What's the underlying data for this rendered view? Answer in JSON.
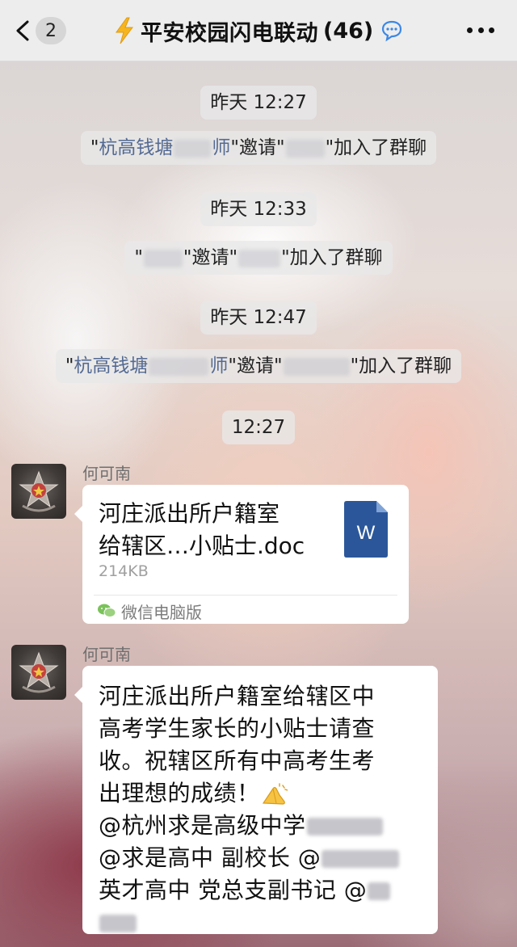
{
  "header": {
    "unread_count": "2",
    "title": "平安校园闪电联动",
    "member_count": "(46)"
  },
  "system_messages": [
    {
      "time": "昨天 12:27",
      "quote1": "\"",
      "inviter": "杭高钱塘",
      "inviter_suffix": "师",
      "mid": "\"邀请\"",
      "end": "\"加入了群聊"
    },
    {
      "time": "昨天 12:33",
      "quote1": "\"",
      "mid": "\"邀请\"",
      "end": "\"加入了群聊"
    },
    {
      "time": "昨天 12:47",
      "quote1": "\"",
      "inviter": "杭高钱塘",
      "inviter_suffix": "师",
      "mid": "\"邀请\"",
      "end": "\"加入了群聊"
    }
  ],
  "time_divider": "12:27",
  "messages": [
    {
      "sender": "何可南",
      "file_name_line1": "河庄派出所户籍室",
      "file_name_line2": "给辖区…小贴士.doc",
      "file_size": "214KB",
      "file_icon_letter": "W",
      "source": "微信电脑版"
    },
    {
      "sender": "何可南",
      "lines": [
        "河庄派出所户籍室给辖区中",
        "高考学生家长的小贴士请查",
        "收。祝辖区所有中高考生考",
        "出理想的成绩！",
        "@杭州求是高级中学",
        "@求是高中 副校长 @",
        "英才高中 党总支副书记 @"
      ]
    }
  ],
  "colors": {
    "topbar_bg": "#ededed",
    "link_blue": "#546a93",
    "doc_icon_blue": "#2b579a"
  }
}
